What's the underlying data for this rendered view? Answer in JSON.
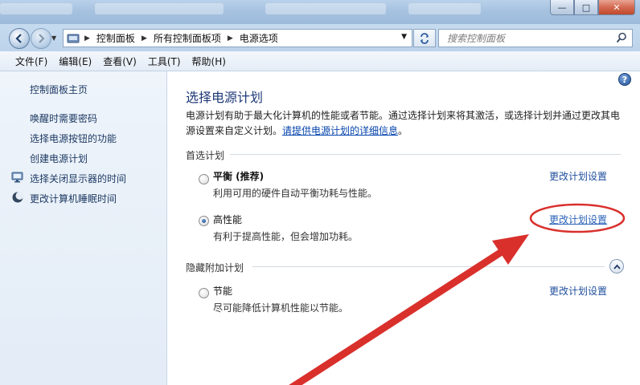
{
  "window": {
    "min_label": "—",
    "max_label": "□",
    "close_label": "✕"
  },
  "address": {
    "crumbs": [
      "控制面板",
      "所有控制面板项",
      "电源选项"
    ]
  },
  "search": {
    "placeholder": "搜索控制面板"
  },
  "menu": [
    "文件(F)",
    "编辑(E)",
    "查看(V)",
    "工具(T)",
    "帮助(H)"
  ],
  "sidebar": {
    "home": "控制面板主页",
    "links": [
      "唤醒时需要密码",
      "选择电源按钮的功能",
      "创建电源计划",
      "选择关闭显示器的时间",
      "更改计算机睡眠时间"
    ]
  },
  "main": {
    "title": "选择电源计划",
    "intro_text": "电源计划有助于最大化计算机的性能或者节能。通过选择计划来将其激活，或选择计划并通过更改其电源设置来自定义计划。",
    "intro_link": "请提供电源计划的详细信息",
    "intro_end": "。",
    "preferred_heading": "首选计划",
    "hidden_heading": "隐藏附加计划",
    "plans": [
      {
        "name": "平衡 (推荐)",
        "desc": "利用可用的硬件自动平衡功耗与性能。",
        "link": "更改计划设置",
        "selected": false
      },
      {
        "name": "高性能",
        "desc": "有利于提高性能，但会增加功耗。",
        "link": "更改计划设置",
        "selected": true
      },
      {
        "name": "节能",
        "desc": "尽可能降低计算机性能以节能。",
        "link": "更改计划设置",
        "selected": false
      }
    ]
  },
  "colors": {
    "accent": "#1e3978",
    "link": "#1f4e9c",
    "annotation": "#d9302c"
  }
}
